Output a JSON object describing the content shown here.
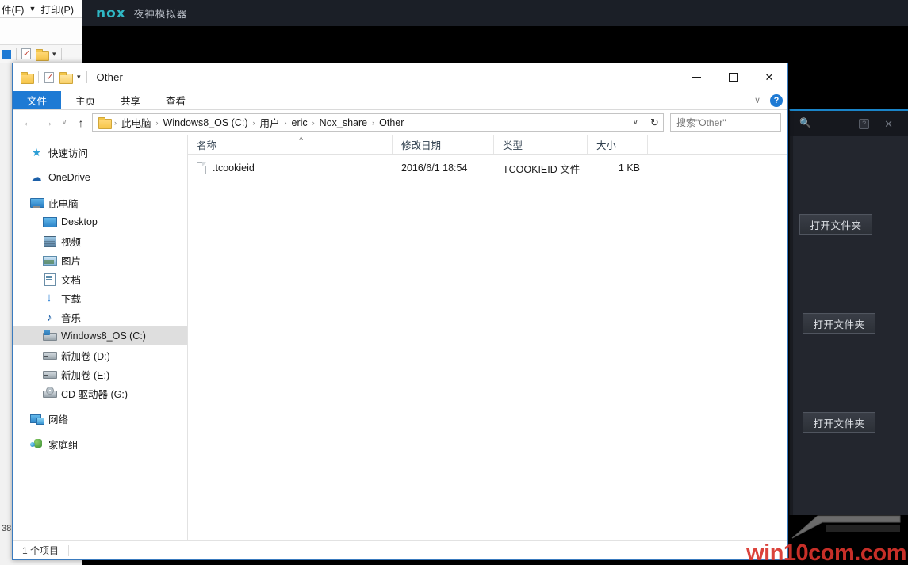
{
  "background_window": {
    "menu_items": [
      "件(F)",
      "打印(P)"
    ],
    "caret": "▼",
    "partial_number": "38"
  },
  "nox": {
    "logo_text": "nox",
    "title": "夜神模拟器",
    "panel": {
      "help_icon": "?",
      "close_icon": "✕",
      "buttons": [
        {
          "label": "打开文件夹"
        },
        {
          "label": "打开文件夹"
        },
        {
          "label": "打开文件夹"
        }
      ]
    }
  },
  "explorer": {
    "titlebar": {
      "title": "Other",
      "quick_access": [
        "properties-icon",
        "new-folder-icon"
      ],
      "caret": "▾",
      "minimize": "─",
      "maximize": "□",
      "close": "✕"
    },
    "ribbon": {
      "tabs": [
        {
          "label": "文件",
          "active": true
        },
        {
          "label": "主页",
          "active": false
        },
        {
          "label": "共享",
          "active": false
        },
        {
          "label": "查看",
          "active": false
        }
      ],
      "expand_caret": "∨",
      "help": "?"
    },
    "address": {
      "back": "←",
      "forward": "→",
      "recent": "∨",
      "up": "↑",
      "crumbs": [
        "此电脑",
        "Windows8_OS (C:)",
        "用户",
        "eric",
        "Nox_share",
        "Other"
      ],
      "separator": "›",
      "dropdown_caret": "∨",
      "refresh": "↻",
      "search_placeholder": "搜索\"Other\"",
      "search_value": "",
      "search_icon": "ᴘ"
    },
    "navpane": {
      "groups": [
        {
          "items": [
            {
              "label": "快速访问",
              "icon": "ic-star",
              "indent": false,
              "selected": false
            }
          ]
        },
        {
          "items": [
            {
              "label": "OneDrive",
              "icon": "ic-cloud",
              "indent": false,
              "selected": false
            }
          ]
        },
        {
          "items": [
            {
              "label": "此电脑",
              "icon": "ic-pc",
              "indent": false,
              "selected": false
            },
            {
              "label": "Desktop",
              "icon": "ic-desk",
              "indent": true,
              "selected": false
            },
            {
              "label": "视频",
              "icon": "ic-vid",
              "indent": true,
              "selected": false
            },
            {
              "label": "图片",
              "icon": "ic-pic",
              "indent": true,
              "selected": false
            },
            {
              "label": "文档",
              "icon": "ic-doc",
              "indent": true,
              "selected": false
            },
            {
              "label": "下载",
              "icon": "ic-dl",
              "indent": true,
              "selected": false
            },
            {
              "label": "音乐",
              "icon": "ic-music",
              "indent": true,
              "selected": false
            },
            {
              "label": "Windows8_OS (C:)",
              "icon": "ic-drivec",
              "indent": true,
              "selected": true
            },
            {
              "label": "新加卷 (D:)",
              "icon": "ic-drive",
              "indent": true,
              "selected": false
            },
            {
              "label": "新加卷 (E:)",
              "icon": "ic-drive",
              "indent": true,
              "selected": false
            },
            {
              "label": "CD 驱动器 (G:)",
              "icon": "ic-cd",
              "indent": true,
              "selected": false
            }
          ]
        },
        {
          "items": [
            {
              "label": "网络",
              "icon": "ic-net",
              "indent": false,
              "selected": false
            }
          ]
        },
        {
          "items": [
            {
              "label": "家庭组",
              "icon": "ic-home",
              "indent": false,
              "selected": false
            }
          ]
        }
      ]
    },
    "filelist": {
      "columns": [
        {
          "label": "名称",
          "key": "name",
          "sorted": true,
          "sort_arrow": "˄"
        },
        {
          "label": "修改日期",
          "key": "date",
          "sorted": false
        },
        {
          "label": "类型",
          "key": "type",
          "sorted": false
        },
        {
          "label": "大小",
          "key": "size",
          "sorted": false
        }
      ],
      "rows": [
        {
          "name": ".tcookieid",
          "date": "2016/6/1 18:54",
          "type": "TCOOKIEID 文件",
          "size": "1 KB",
          "icon": "generic-file-icon"
        }
      ]
    },
    "statusbar": {
      "item_count": "1 个项目"
    }
  },
  "watermark": {
    "text": "win10com.com",
    "color": "#d8342c"
  }
}
